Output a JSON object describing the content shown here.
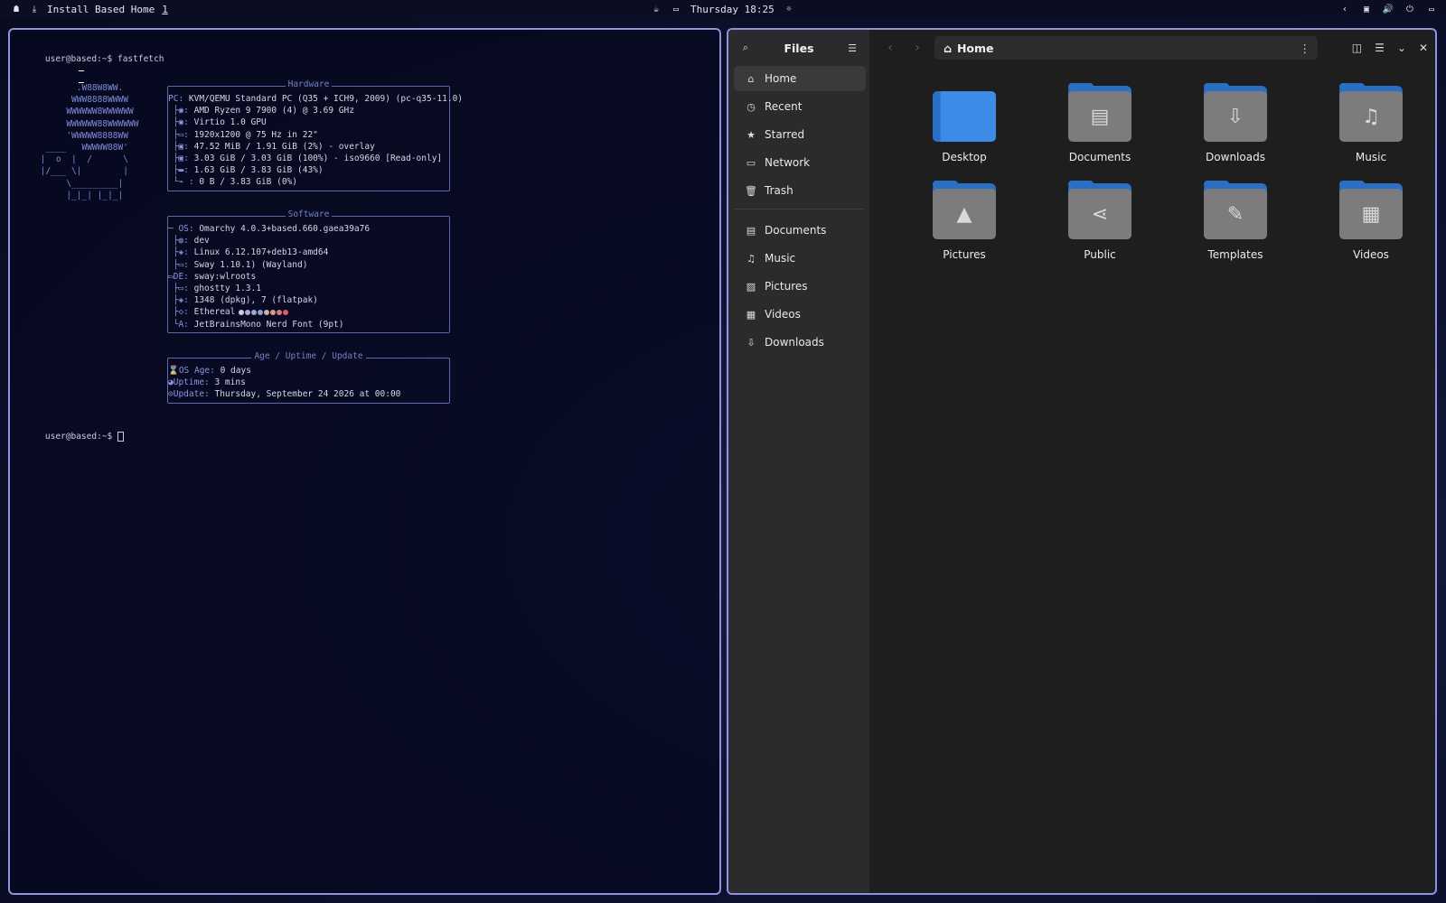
{
  "topbar": {
    "window_title": "Install Based Home",
    "workspace": "1",
    "clock": "Thursday 18:25"
  },
  "terminal": {
    "prompt": "user@based:~$",
    "command": "fastfetch",
    "ascii_art": "        .W88W8WW.\n       WWW8888WWWW\n      WWWWWW8WWWWWW\n      WWWWWW88WWWWWW\n      'WWWWW8888WW\n  ____   WWWWW88W'\n |  o  |  /      \\\n |/___ \\|        |\n      \\_________|\n      |_|_| |_|_|",
    "hardware": {
      "title": "Hardware",
      "rows": [
        {
          "k": "PC:",
          "v": "KVM/QEMU Standard PC (Q35 + ICH9, 2009) (pc-q35-11.0)"
        },
        {
          "k": " ├◉:",
          "v": "AMD Ryzen 9 7900 (4) @ 3.69 GHz"
        },
        {
          "k": " ├◉:",
          "v": "Virtio 1.0 GPU"
        },
        {
          "k": " ├▭:",
          "v": "1920x1200 @ 75 Hz in 22\""
        },
        {
          "k": " ├▣:",
          "v": "47.52 MiB / 1.91 GiB (2%) - overlay"
        },
        {
          "k": " ├▣:",
          "v": "3.03 GiB / 3.03 GiB (100%) - iso9660 [Read-only]"
        },
        {
          "k": " ├▬:",
          "v": "1.63 GiB / 3.83 GiB (43%)"
        },
        {
          "k": " └⌁ :",
          "v": "0 B / 3.83 GiB (0%)"
        }
      ]
    },
    "software": {
      "title": "Software",
      "rows": [
        {
          "k": "─ OS:",
          "v": "Omarchy 4.0.3+based.660.gaea39a76"
        },
        {
          "k": " ├◍:",
          "v": "dev"
        },
        {
          "k": " ├◈:",
          "v": "Linux 6.12.107+deb13-amd64"
        },
        {
          "k": " ├▭:",
          "v": "Sway 1.10.1) (Wayland)"
        },
        {
          "k": "▭DE:",
          "v": "sway:wlroots"
        },
        {
          "k": " ├▭:",
          "v": "ghostty 1.3.1"
        },
        {
          "k": " ├◈:",
          "v": "1348 (dpkg), 7 (flatpak)"
        },
        {
          "k": " ├◇:",
          "v": "Ethereal"
        },
        {
          "k": " └A:",
          "v": "JetBrainsMono Nerd Font (9pt)"
        }
      ],
      "palette": [
        "#c9cde0",
        "#b5a7c8",
        "#9aa6d4",
        "#8fa0c9",
        "#c7b59a",
        "#d69a8c",
        "#d07a84",
        "#e05a6a"
      ]
    },
    "age": {
      "title": "Age / Uptime / Update",
      "rows": [
        {
          "k": "⌛OS Age:",
          "v": "0 days"
        },
        {
          "k": "◕Uptime:",
          "v": "3 mins"
        },
        {
          "k": "⊙Update:",
          "v": "Thursday, September 24 2026 at 00:00"
        }
      ]
    }
  },
  "files": {
    "app_title": "Files",
    "location": "Home",
    "sidebar_primary": [
      {
        "label": "Home",
        "icon": "⌂"
      },
      {
        "label": "Recent",
        "icon": "◷"
      },
      {
        "label": "Starred",
        "icon": "★"
      },
      {
        "label": "Network",
        "icon": "▭"
      },
      {
        "label": "Trash",
        "icon": "🗑"
      }
    ],
    "sidebar_bookmarks": [
      {
        "label": "Documents",
        "icon": "▤"
      },
      {
        "label": "Music",
        "icon": "♫"
      },
      {
        "label": "Pictures",
        "icon": "▨"
      },
      {
        "label": "Videos",
        "icon": "▦"
      },
      {
        "label": "Downloads",
        "icon": "⇩"
      }
    ],
    "items": [
      {
        "label": "Desktop",
        "glyph": ""
      },
      {
        "label": "Documents",
        "glyph": "▤"
      },
      {
        "label": "Downloads",
        "glyph": "⇩"
      },
      {
        "label": "Music",
        "glyph": "♫"
      },
      {
        "label": "Pictures",
        "glyph": "▲"
      },
      {
        "label": "Public",
        "glyph": "⋖"
      },
      {
        "label": "Templates",
        "glyph": "✎"
      },
      {
        "label": "Videos",
        "glyph": "▦"
      }
    ]
  }
}
